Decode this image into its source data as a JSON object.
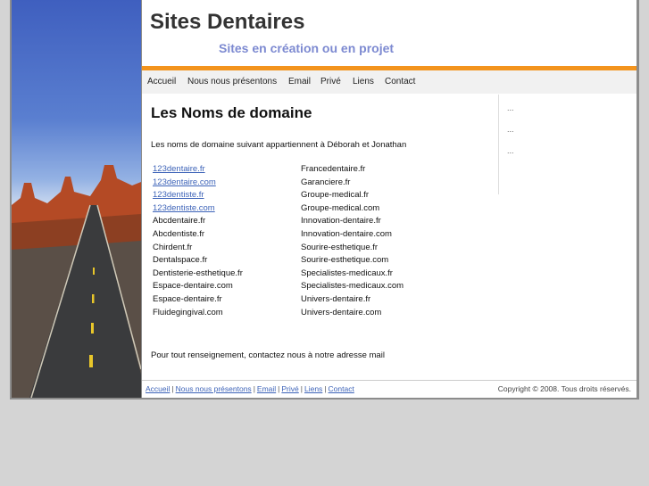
{
  "header": {
    "title": "Sites Dentaires",
    "subtitle": "Sites en création ou en projet"
  },
  "nav": [
    "Accueil",
    "Nous nous présentons",
    "Email",
    "Privé",
    "Liens",
    "Contact"
  ],
  "content": {
    "title": "Les Noms de domaine",
    "intro": "Les noms de domaine suivant appartiennent à Déborah et Jonathan",
    "col1": [
      {
        "text": "123dentaire.fr",
        "link": true
      },
      {
        "text": "123dentaire.com",
        "link": true
      },
      {
        "text": "123dentiste.fr",
        "link": true
      },
      {
        "text": "123dentiste.com ",
        "link": true
      },
      {
        "text": "Abcdentaire.fr",
        "link": false
      },
      {
        "text": "Abcdentiste.fr",
        "link": false
      },
      {
        "text": "Chirdent.fr",
        "link": false
      },
      {
        "text": "Dentalspace.fr",
        "link": false
      },
      {
        "text": "Dentisterie-esthetique.fr",
        "link": false
      },
      {
        "text": "Espace-dentaire.com",
        "link": false
      },
      {
        "text": "Espace-dentaire.fr",
        "link": false
      },
      {
        "text": "Fluidegingival.com",
        "link": false
      }
    ],
    "col2": [
      "Francedentaire.fr",
      "Garanciere.fr",
      "Groupe-medical.fr",
      "Groupe-medical.com",
      "Innovation-dentaire.fr",
      "Innovation-dentaire.com",
      "Sourire-esthetique.fr",
      "Sourire-esthetique.com",
      "Specialistes-medicaux.fr",
      "Specialistes-medicaux.com",
      "Univers-dentaire.fr",
      "Univers-dentaire.com"
    ],
    "contact_line": "Pour tout renseignement, contactez nous à notre adresse mail"
  },
  "sidebar": [
    "...",
    "...",
    "..."
  ],
  "footer": {
    "links": [
      "Accueil",
      "Nous nous présentons",
      "Email",
      "Privé",
      "Liens",
      "Contact"
    ],
    "separator": "|",
    "copyright": "Copyright © 2008. Tous droits réservés."
  },
  "colors": {
    "accent_bar": "#f3941d",
    "subtitle": "#7d8ad1",
    "link": "#3d63b8"
  }
}
